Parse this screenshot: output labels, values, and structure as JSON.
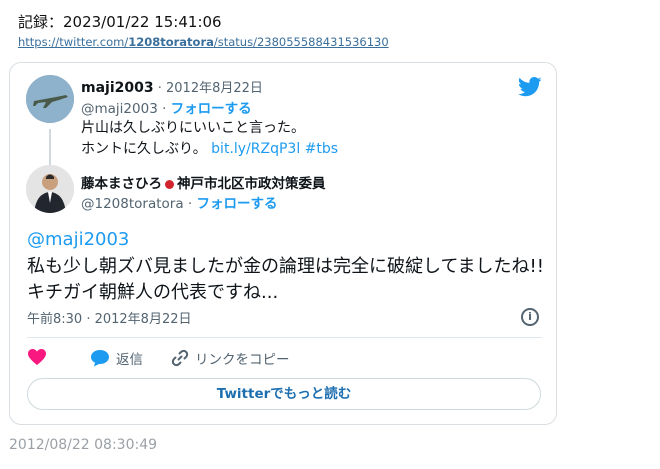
{
  "header": {
    "record": "記録：2023/01/22 15:41:06",
    "url_prefix": "https://twitter.com/",
    "url_user": "1208toratora",
    "url_suffix": "/status/238055588431536130"
  },
  "quoted": {
    "name": "maji2003",
    "date": " · 2012年8月22日",
    "handle": "@maji2003 · ",
    "follow": "フォローする",
    "line1": "片山は久しぶりにいいこと言った。",
    "line2_text": "ホントに久しぶり。 ",
    "line2_link": "bit.ly/RZqP3l #tbs"
  },
  "author": {
    "name_a": "藤本まさひろ",
    "name_b": "神戸市北区市政対策委員",
    "handle": "@1208toratora · ",
    "follow": "フォローする"
  },
  "tweet": {
    "mention": "@maji2003",
    "text": "私も少し朝ズバ見ましたが金の論理は完全に破綻してましたね!!キチガイ朝鮮人の代表ですね...",
    "timestamp": "午前8:30 · 2012年8月22日"
  },
  "actions": {
    "reply": "返信",
    "copy_link": "リンクをコピー"
  },
  "more_button": "Twitterでもっと読む",
  "footer": "2012/08/22 08:30:49",
  "colors": {
    "twitter_blue": "#1d9bf0",
    "heart": "#f91880",
    "text_secondary": "#536471"
  },
  "icons": [
    "twitter-bird-icon",
    "info-icon",
    "heart-icon",
    "reply-bubble-icon",
    "link-icon"
  ]
}
